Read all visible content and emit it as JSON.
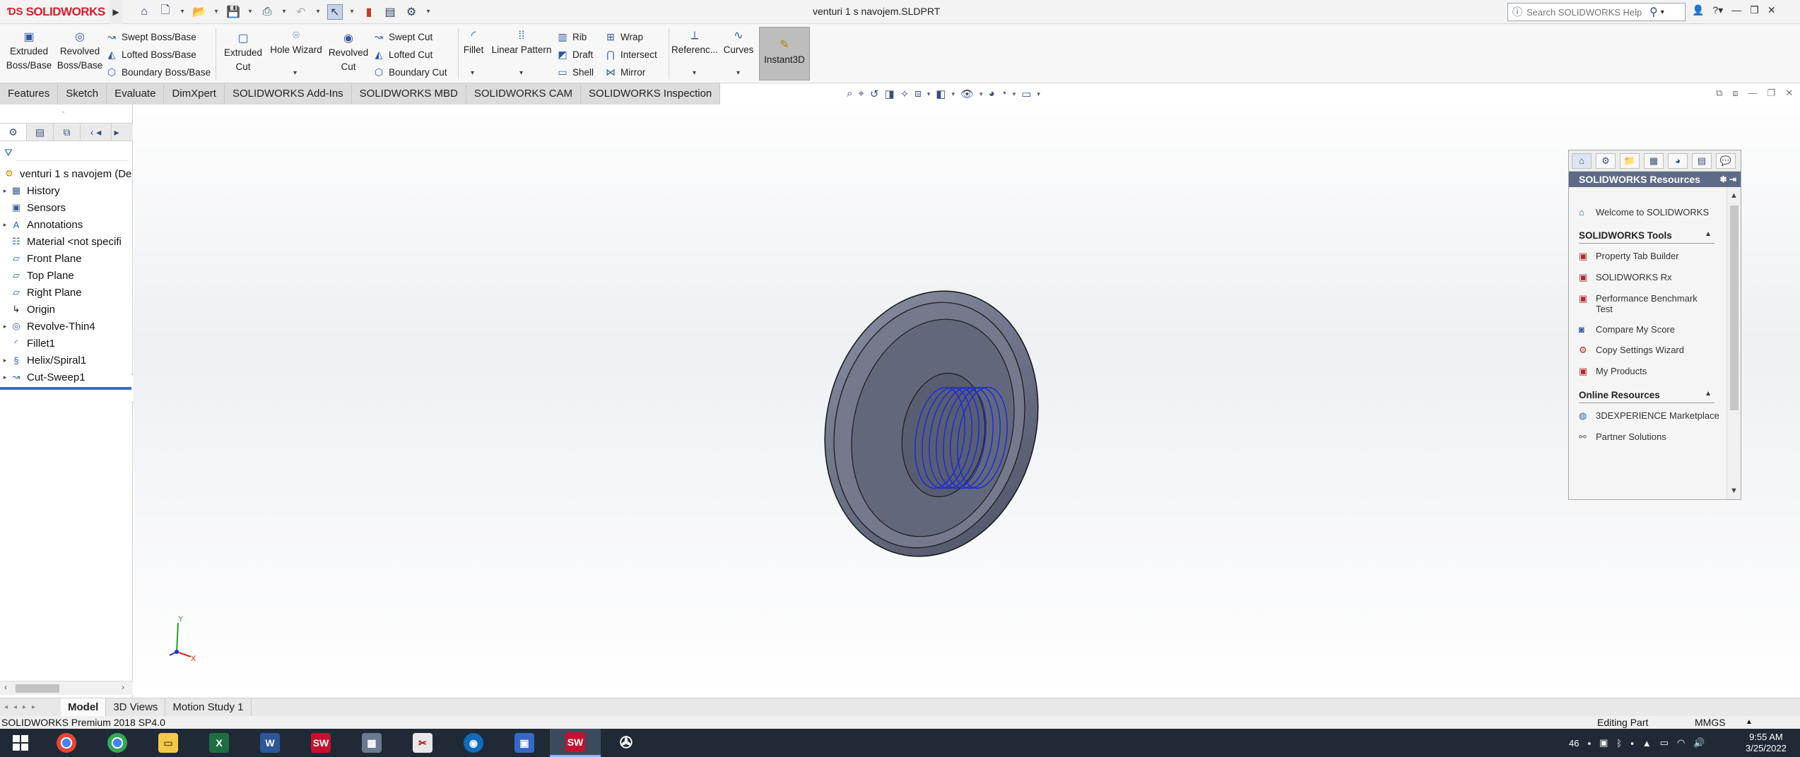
{
  "app": {
    "brand": "SOLIDWORKS",
    "document_title": "venturi 1 s navojem.SLDPRT",
    "search_placeholder": "Search SOLIDWORKS Help"
  },
  "ribbon": {
    "extruded_boss": [
      "Extruded",
      "Boss/Base"
    ],
    "revolved_boss": [
      "Revolved",
      "Boss/Base"
    ],
    "swept_boss": "Swept Boss/Base",
    "lofted_boss": "Lofted Boss/Base",
    "boundary_boss": "Boundary Boss/Base",
    "extruded_cut": [
      "Extruded",
      "Cut"
    ],
    "hole_wizard": "Hole Wizard",
    "revolved_cut": [
      "Revolved",
      "Cut"
    ],
    "swept_cut": "Swept Cut",
    "lofted_cut": "Lofted Cut",
    "boundary_cut": "Boundary Cut",
    "fillet": "Fillet",
    "linear_pattern": "Linear Pattern",
    "rib": "Rib",
    "draft": "Draft",
    "shell": "Shell",
    "wrap": "Wrap",
    "intersect": "Intersect",
    "mirror": "Mirror",
    "reference": "Referenc...",
    "curves": "Curves",
    "instant3d": "Instant3D"
  },
  "tabs": [
    {
      "label": "Features",
      "active": true
    },
    {
      "label": "Sketch",
      "active": false
    },
    {
      "label": "Evaluate",
      "active": false
    },
    {
      "label": "DimXpert",
      "active": false
    },
    {
      "label": "SOLIDWORKS Add-Ins",
      "active": false
    },
    {
      "label": "SOLIDWORKS MBD",
      "active": false
    },
    {
      "label": "SOLIDWORKS CAM",
      "active": false
    },
    {
      "label": "SOLIDWORKS Inspection",
      "active": false
    }
  ],
  "feature_tree": {
    "root": "venturi 1 s navojem  (De",
    "items": [
      {
        "label": "History",
        "icon": "history-icon",
        "expandable": true
      },
      {
        "label": "Sensors",
        "icon": "sensors-icon",
        "expandable": false
      },
      {
        "label": "Annotations",
        "icon": "annotations-icon",
        "expandable": true
      },
      {
        "label": "Material <not specifi",
        "icon": "material-icon",
        "expandable": false
      },
      {
        "label": "Front Plane",
        "icon": "plane-icon",
        "expandable": false
      },
      {
        "label": "Top Plane",
        "icon": "plane-icon",
        "expandable": false
      },
      {
        "label": "Right Plane",
        "icon": "plane-icon",
        "expandable": false
      },
      {
        "label": "Origin",
        "icon": "origin-icon",
        "expandable": false
      },
      {
        "label": "Revolve-Thin4",
        "icon": "revolve-icon",
        "expandable": true
      },
      {
        "label": "Fillet1",
        "icon": "fillet-icon",
        "expandable": false
      },
      {
        "label": "Helix/Spiral1",
        "icon": "helix-icon",
        "expandable": true
      },
      {
        "label": "Cut-Sweep1",
        "icon": "cut-sweep-icon",
        "expandable": true
      }
    ]
  },
  "task_pane": {
    "title": "SOLIDWORKS Resources",
    "welcome": "Welcome to SOLIDWORKS",
    "tools_header": "SOLIDWORKS Tools",
    "tools": [
      "Property Tab Builder",
      "SOLIDWORKS Rx",
      "Performance Benchmark Test",
      "Compare My Score",
      "Copy Settings Wizard",
      "My Products"
    ],
    "online_header": "Online Resources",
    "online": [
      "3DEXPERIENCE Marketplace",
      "Partner Solutions"
    ]
  },
  "bottom_tabs": [
    {
      "label": "Model",
      "active": true
    },
    {
      "label": "3D Views",
      "active": false
    },
    {
      "label": "Motion Study 1",
      "active": false
    }
  ],
  "status": {
    "product": "SOLIDWORKS Premium 2018 SP4.0",
    "editing": "Editing Part",
    "units": "MMGS"
  },
  "taskbar": {
    "tray_number": "46",
    "time": "9:55 AM",
    "date": "3/25/2022"
  },
  "colors": {
    "accent": "#d0202b",
    "part": "#6e7489",
    "thread": "#1f2fd1",
    "taskpane_header": "#5d6b86"
  }
}
